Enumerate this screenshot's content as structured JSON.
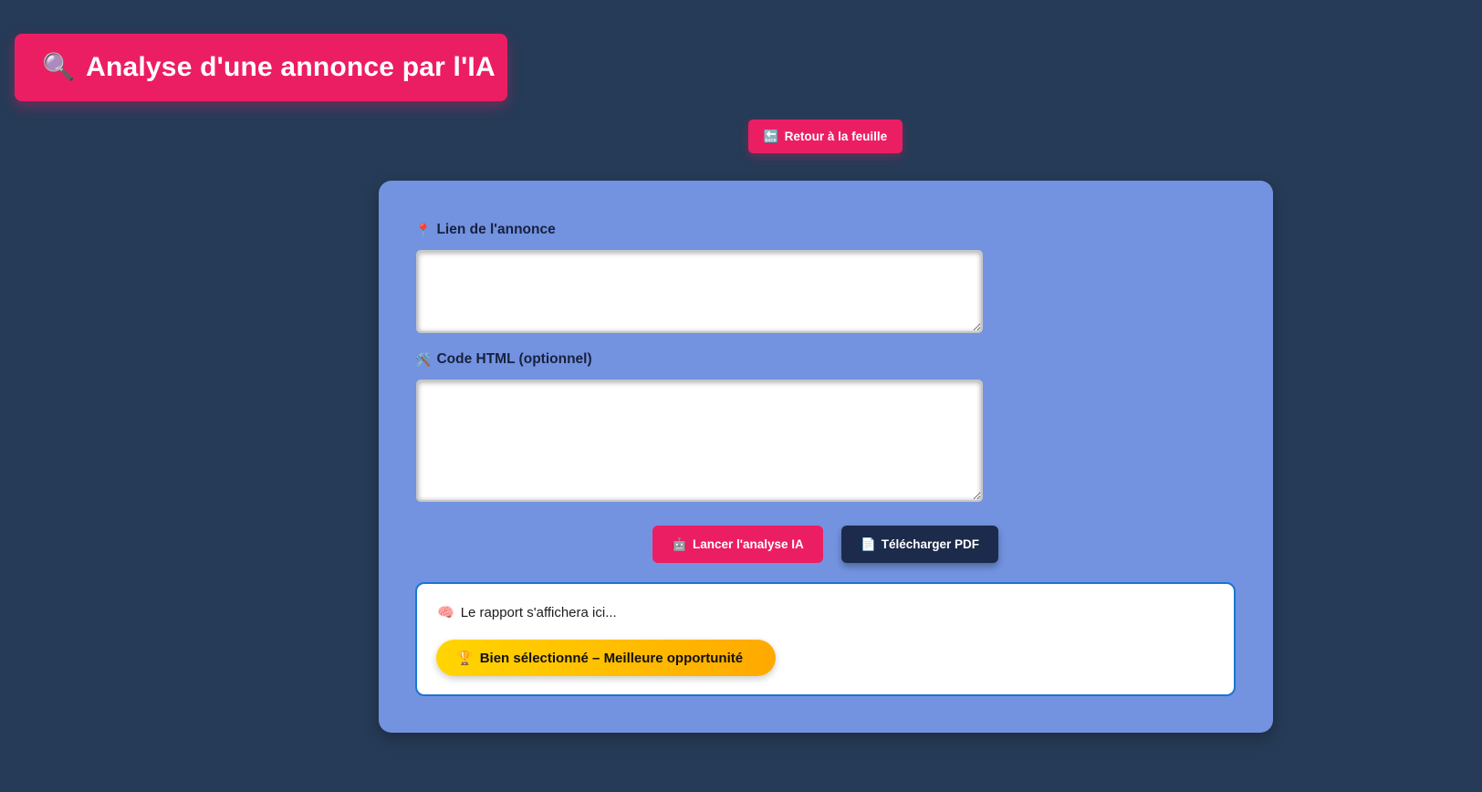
{
  "header": {
    "icon": "magnifier-icon",
    "icon_glyph": "🔍",
    "title": "Analyse d'une annonce par l'IA"
  },
  "nav": {
    "back_icon": "back-arrow-icon",
    "back_icon_glyph": "🔙",
    "back_label": "Retour à la feuille"
  },
  "form": {
    "link_field": {
      "icon": "pin-icon",
      "icon_glyph": "📍",
      "label": "Lien de l'annonce",
      "value": ""
    },
    "html_field": {
      "icon": "tools-icon",
      "icon_glyph": "🛠️",
      "label": "Code HTML (optionnel)",
      "value": ""
    }
  },
  "actions": {
    "analyze_icon": "robot-icon",
    "analyze_icon_glyph": "🤖",
    "analyze_label": "Lancer l'analyse IA",
    "pdf_icon": "document-icon",
    "pdf_icon_glyph": "📄",
    "pdf_label": "Télécharger PDF"
  },
  "report": {
    "icon": "brain-icon",
    "icon_glyph": "🧠",
    "placeholder": "Le rapport s'affichera ici...",
    "badge_icon": "trophy-icon",
    "badge_icon_glyph": "🏆",
    "badge_label": "Bien sélectionné – Meilleure opportunité"
  },
  "colors": {
    "background": "#263b57",
    "accent": "#ec1e63",
    "card": "#7393e0",
    "dark_button": "#1c2a4b",
    "report_border": "#1776d4",
    "badge_gradient_start": "#ffd500",
    "badge_gradient_end": "#ffa900"
  }
}
